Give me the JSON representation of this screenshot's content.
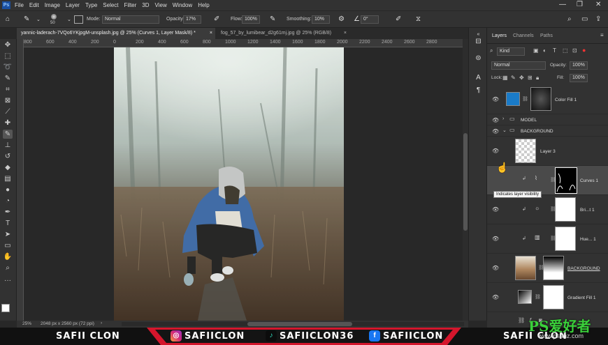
{
  "app": {
    "logo": "Ps"
  },
  "menu": [
    "File",
    "Edit",
    "Image",
    "Layer",
    "Type",
    "Select",
    "Filter",
    "3D",
    "View",
    "Window",
    "Help"
  ],
  "window_controls": {
    "minimize": "—",
    "restore": "❐",
    "close": "✕"
  },
  "options": {
    "brush_size": "50",
    "mode_label": "Mode:",
    "mode_value": "Normal",
    "opacity_label": "Opacity:",
    "opacity_value": "17%",
    "flow_label": "Flow:",
    "flow_value": "100%",
    "smoothing_label": "Smoothing:",
    "smoothing_value": "10%",
    "angle_value": "0°"
  },
  "doc_tabs": [
    {
      "label": "yannic-laderach-7VQo6YKjpgM-unsplash.jpg @ 25% (Curves 1, Layer Mask/8) *",
      "close": "×"
    },
    {
      "label": "fog_57_by_lumibear_d2g61mj.jpg @ 25% (RGB/8)",
      "close": "×"
    }
  ],
  "ruler_top": [
    "800",
    "600",
    "400",
    "200",
    "0",
    "200",
    "400",
    "600",
    "800",
    "1000",
    "1200",
    "1400",
    "1600",
    "1800",
    "2000",
    "2200",
    "2400",
    "2600",
    "2800"
  ],
  "status": {
    "zoom": "25%",
    "doc_size": "2048 px x 2560 px (72 ppi)"
  },
  "panels": {
    "tabs": [
      "Layers",
      "Channels",
      "Paths"
    ],
    "filter_kind": "Kind",
    "blend_mode": "Normal",
    "opacity_label": "Opacity:",
    "opacity_value": "100%",
    "lock_label": "Lock:",
    "fill_label": "Fill:",
    "fill_value": "100%"
  },
  "layers": [
    {
      "name": "Color Fill 1",
      "kind": "fill",
      "color": "#1a7bc8"
    },
    {
      "name": "MODEL",
      "kind": "group-closed"
    },
    {
      "name": "BACKGROUND",
      "kind": "group-open"
    },
    {
      "name": "Layer 3",
      "kind": "pixel"
    },
    {
      "name": "Curves 1",
      "kind": "adjustment"
    },
    {
      "name": "Bri...t 1",
      "kind": "adjustment"
    },
    {
      "name": "Hue... 1",
      "kind": "adjustment"
    },
    {
      "name": "BACKGROUND",
      "kind": "pixel"
    },
    {
      "name": "Gradient Fill 1",
      "kind": "fill"
    }
  ],
  "tooltip": "Indicates layer visibility",
  "footer": {
    "left_name": "SAFII CLON",
    "instagram": "SAFIICLON",
    "tiktok": "SAFIICLON36",
    "facebook": "SAFIICLON",
    "right_name": "SAFII CLON",
    "colors": {
      "red": "#d4162c",
      "bar": "#111111"
    }
  },
  "watermark": {
    "logo": "PS爱好者",
    "url": "www.psahz.com"
  }
}
